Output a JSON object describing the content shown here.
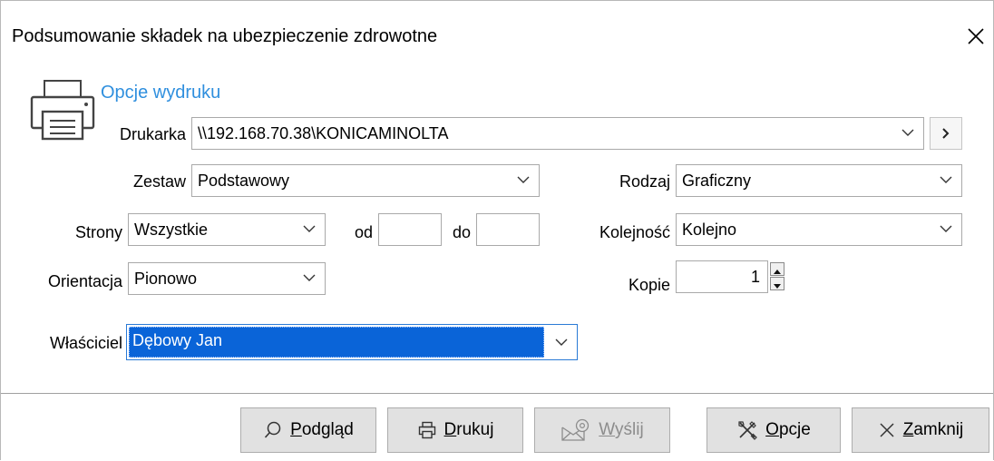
{
  "window": {
    "title": "Podsumowanie składek na ubezpieczenie zdrowotne",
    "close_icon": "close-icon"
  },
  "print_options": {
    "section_label": "Opcje wydruku",
    "printer_icon": "printer-icon",
    "printer": {
      "label": "Drukarka",
      "value": "\\\\192.168.70.38\\KONICAMINOLTA"
    },
    "set": {
      "label": "Zestaw",
      "value": "Podstawowy"
    },
    "kind": {
      "label": "Rodzaj",
      "value": "Graficzny"
    },
    "pages": {
      "label": "Strony",
      "value": "Wszystkie",
      "from_label": "od",
      "from_value": "",
      "to_label": "do",
      "to_value": ""
    },
    "order": {
      "label": "Kolejność",
      "value": "Kolejno"
    },
    "orientation": {
      "label": "Orientacja",
      "value": "Pionowo"
    },
    "copies": {
      "label": "Kopie",
      "value": "1"
    },
    "owner": {
      "label": "Właściciel",
      "value": "Dębowy Jan"
    }
  },
  "buttons": {
    "preview": {
      "first": "P",
      "rest": "odgląd",
      "icon": "search-icon"
    },
    "print": {
      "first": "D",
      "rest": "rukuj",
      "icon": "printer-icon"
    },
    "send": {
      "first": "W",
      "rest": "yślij",
      "icon": "mail-icon"
    },
    "options": {
      "first": "O",
      "rest": "pcje",
      "icon": "tools-icon"
    },
    "close": {
      "first": "Z",
      "rest": "amknij",
      "icon": "close-icon"
    }
  }
}
